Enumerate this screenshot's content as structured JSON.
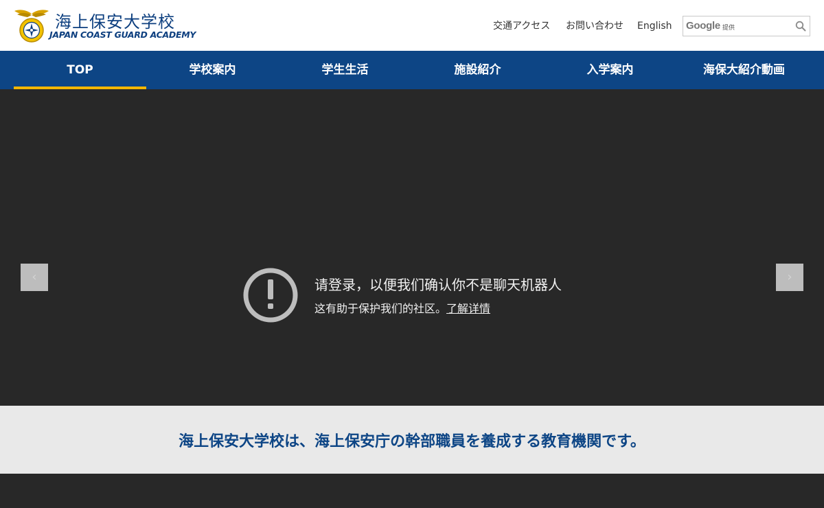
{
  "header": {
    "title": "海上保安大学校",
    "subtitle": "JAPAN COAST GUARD ACADEMY",
    "util_links": [
      {
        "label": "交通アクセス"
      },
      {
        "label": "お問い合わせ"
      },
      {
        "label": "English"
      }
    ],
    "search": {
      "brand": "Google",
      "provided": "提供",
      "value": "",
      "placeholder": ""
    }
  },
  "nav": {
    "items": [
      {
        "label": "TOP",
        "active": true
      },
      {
        "label": "学校案内",
        "active": false
      },
      {
        "label": "学生生活",
        "active": false
      },
      {
        "label": "施設紹介",
        "active": false
      },
      {
        "label": "入学案内",
        "active": false
      },
      {
        "label": "海保大紹介動画",
        "active": false
      }
    ]
  },
  "hero": {
    "prev_glyph": "‹",
    "next_glyph": "›",
    "notice_title": "请登录，以便我们确认你不是聊天机器人",
    "notice_text": "这有助于保护我们的社区。",
    "notice_link": "了解详情"
  },
  "tagline": "海上保安大学校は、海上保安庁の幹部職員を養成する教育機関です。",
  "colors": {
    "brand_blue": "#0d4585",
    "active_underline": "#f2b600",
    "hero_bg": "#282828",
    "tagline_bg": "#e9e9e9"
  }
}
